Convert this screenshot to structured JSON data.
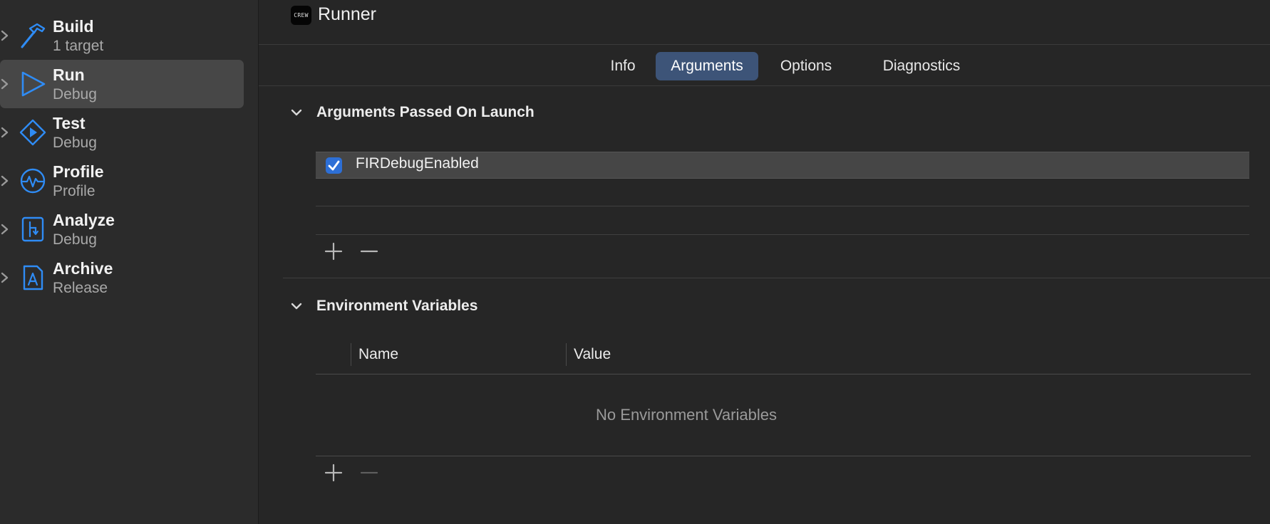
{
  "sidebar": {
    "items": [
      {
        "title": "Build",
        "subtitle": "1 target",
        "icon": "hammer-icon"
      },
      {
        "title": "Run",
        "subtitle": "Debug",
        "icon": "play-icon"
      },
      {
        "title": "Test",
        "subtitle": "Debug",
        "icon": "test-diamond-icon"
      },
      {
        "title": "Profile",
        "subtitle": "Profile",
        "icon": "gauge-icon"
      },
      {
        "title": "Analyze",
        "subtitle": "Debug",
        "icon": "analyze-icon"
      },
      {
        "title": "Archive",
        "subtitle": "Release",
        "icon": "archive-icon"
      }
    ],
    "selected": "Run"
  },
  "header": {
    "app_icon_text": "CREW",
    "title": "Runner"
  },
  "tabs": [
    {
      "label": "Info"
    },
    {
      "label": "Arguments"
    },
    {
      "label": "Options"
    },
    {
      "label": "Diagnostics"
    }
  ],
  "selected_tab": "Arguments",
  "arguments_section": {
    "title": "Arguments Passed On Launch",
    "rows": [
      {
        "enabled": true,
        "value": "FIRDebugEnabled"
      }
    ]
  },
  "env_section": {
    "title": "Environment Variables",
    "columns": [
      "Name",
      "Value"
    ],
    "empty_message": "No Environment Variables"
  },
  "colors": {
    "accent": "#3d5478",
    "checkbox": "#2d6fd6",
    "icon_blue": "#2f8cf5"
  }
}
